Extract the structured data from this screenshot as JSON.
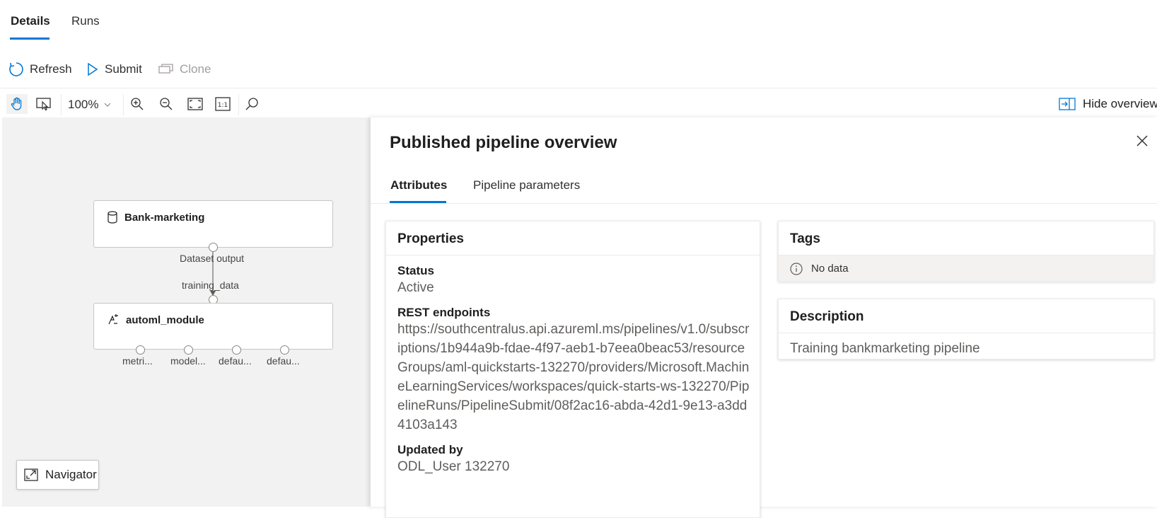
{
  "tabs": {
    "details": "Details",
    "runs": "Runs"
  },
  "commands": {
    "refresh": "Refresh",
    "submit": "Submit",
    "clone": "Clone"
  },
  "toolbar": {
    "zoom": "100%",
    "hide_overview": "Hide overview"
  },
  "canvas": {
    "node1": {
      "title": "Bank-marketing",
      "output_label": "Dataset output"
    },
    "node2": {
      "title": "automl_module",
      "input_label": "training_data",
      "outputs": [
        "metri...",
        "model...",
        "defau...",
        "defau..."
      ]
    },
    "navigator": "Navigator"
  },
  "panel": {
    "title": "Published pipeline overview",
    "tabs": {
      "attributes": "Attributes",
      "parameters": "Pipeline parameters"
    },
    "properties": {
      "header": "Properties",
      "status_label": "Status",
      "status_value": "Active",
      "endpoints_label": "REST endpoints",
      "endpoints_value": "https://southcentralus.api.azureml.ms/pipelines/v1.0/subscriptions/1b944a9b-fdae-4f97-aeb1-b7eea0beac53/resourceGroups/aml-quickstarts-132270/providers/Microsoft.MachineLearningServices/workspaces/quick-starts-ws-132270/PipelineRuns/PipelineSubmit/08f2ac16-abda-42d1-9e13-a3dd4103a143",
      "updated_label": "Updated by",
      "updated_value": "ODL_User 132270"
    },
    "tags": {
      "header": "Tags",
      "empty": "No data"
    },
    "description": {
      "header": "Description",
      "value": "Training bankmarketing pipeline"
    }
  },
  "colors": {
    "accent": "#0078d4",
    "canvas_bg": "#f2f2f2"
  }
}
